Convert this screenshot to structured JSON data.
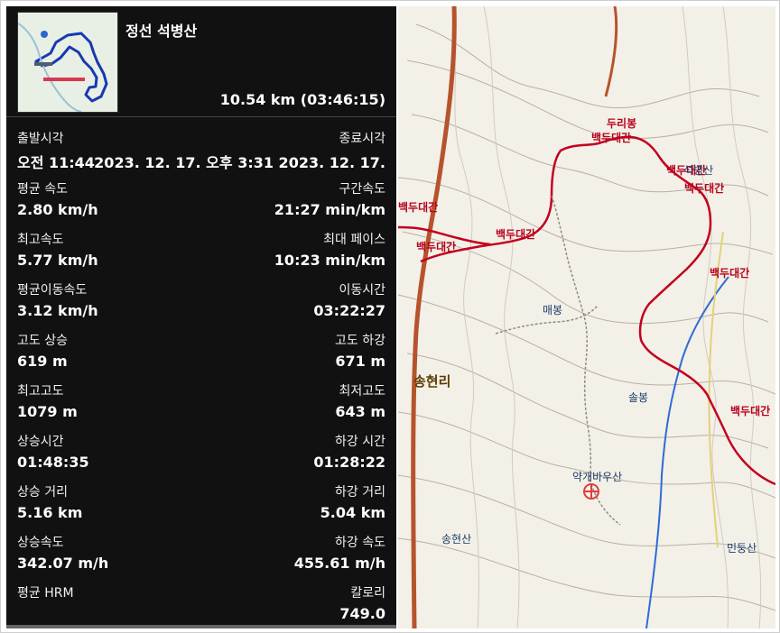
{
  "panel": {
    "title": "정선 석병산",
    "summary": "10.54 km (03:46:15)",
    "stats": [
      {
        "left_label": "출발시각",
        "left_value": "오전 11:44",
        "right_label": "종료시각",
        "right_value": "2023. 12. 17. 오후 3:31 2023. 12. 17."
      },
      {
        "left_label": "평균 속도",
        "left_value": "2.80 km/h",
        "right_label": "구간속도",
        "right_value": "21:27 min/km"
      },
      {
        "left_label": "최고속도",
        "left_value": "5.77 km/h",
        "right_label": "최대 페이스",
        "right_value": "10:23 min/km"
      },
      {
        "left_label": "평균이동속도",
        "left_value": "3.12 km/h",
        "right_label": "이동시간",
        "right_value": "03:22:27"
      },
      {
        "left_label": "고도 상승",
        "left_value": "619 m",
        "right_label": "고도 하강",
        "right_value": "671 m"
      },
      {
        "left_label": "최고고도",
        "left_value": "1079 m",
        "right_label": "최저고도",
        "right_value": "643 m"
      },
      {
        "left_label": "상승시간",
        "left_value": "01:48:35",
        "right_label": "하강 시간",
        "right_value": "01:28:22"
      },
      {
        "left_label": "상승 거리",
        "left_value": "5.16 km",
        "right_label": "하강 거리",
        "right_value": "5.04 km"
      },
      {
        "left_label": "상승속도",
        "left_value": "342.07 m/h",
        "right_label": "하강 속도",
        "right_value": "455.61 m/h"
      },
      {
        "left_label": "평균 HRM",
        "left_value": "",
        "right_label": "칼로리",
        "right_value": "749.0"
      }
    ]
  },
  "map": {
    "labels": [
      {
        "text": "두리봉",
        "class": "red"
      },
      {
        "text": "백두대간",
        "class": "red"
      },
      {
        "text": "백두대간",
        "class": "red"
      },
      {
        "text": "백두대간",
        "class": "red"
      },
      {
        "text": "백두대간",
        "class": "red"
      },
      {
        "text": "백두대간",
        "class": "red"
      },
      {
        "text": "백두대간",
        "class": "red"
      },
      {
        "text": "백두대간",
        "class": "red"
      },
      {
        "text": "백두대간",
        "class": "red"
      },
      {
        "text": "석병산",
        "class": "blue"
      },
      {
        "text": "매봉",
        "class": "blue"
      },
      {
        "text": "솔봉",
        "class": "blue"
      },
      {
        "text": "약개바우산",
        "class": "blue"
      },
      {
        "text": "송현산",
        "class": "blue"
      },
      {
        "text": "민둥산",
        "class": "blue"
      },
      {
        "text": "송현리",
        "class": "dark"
      }
    ]
  },
  "colors": {
    "panel_bg": "#111111",
    "route": "#c3001e",
    "road": "#b5542c",
    "water": "#2d6bd8"
  }
}
